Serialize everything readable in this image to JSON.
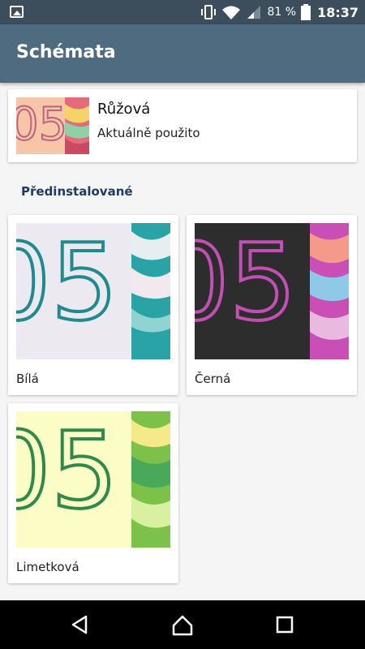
{
  "status_bar": {
    "battery_percent": "81 %",
    "time": "18:37",
    "icons": [
      "gallery-icon",
      "vibrate-icon",
      "wifi-icon",
      "signal-icon",
      "battery-icon"
    ]
  },
  "app_bar": {
    "title": "Schémata"
  },
  "current_theme": {
    "name": "Růžová",
    "status": "Aktuálně použito",
    "colors": {
      "bg": "#f6c6a8",
      "digits": "#c3607c"
    }
  },
  "section": {
    "title": "Předinstalované"
  },
  "themes": [
    {
      "name": "Bílá",
      "colors": {
        "bg": "#eceaf0",
        "digits": "#1f8a8f"
      }
    },
    {
      "name": "Černá",
      "colors": {
        "bg": "#2d2d2d",
        "digits": "#c44fb4"
      }
    },
    {
      "name": "Limetková",
      "colors": {
        "bg": "#fbfcc6",
        "digits": "#2f8a4a"
      }
    }
  ],
  "nav_bar": {
    "icons": [
      "back-icon",
      "home-icon",
      "recents-icon"
    ]
  }
}
